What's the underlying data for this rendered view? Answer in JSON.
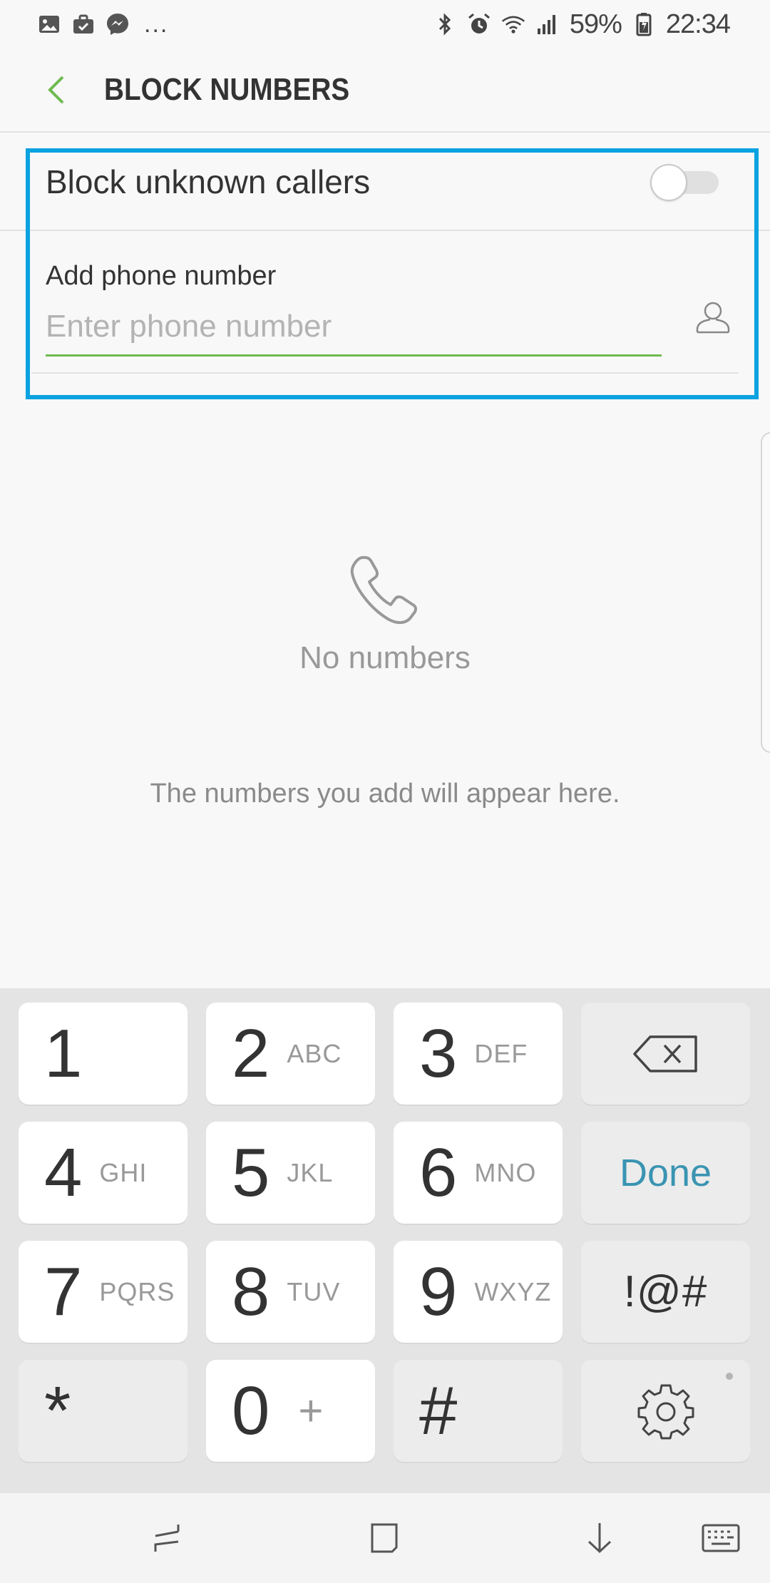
{
  "status_bar": {
    "notification_icons": [
      "gallery-icon",
      "briefcase-icon",
      "messenger-icon"
    ],
    "more_dots": "...",
    "battery_text": "59%",
    "time": "22:34"
  },
  "header": {
    "title": "BLOCK NUMBERS"
  },
  "settings": {
    "block_unknown_label": "Block unknown callers",
    "block_unknown_enabled": false,
    "add_label": "Add phone number",
    "phone_placeholder": "Enter phone number",
    "phone_value": ""
  },
  "empty_state": {
    "title": "No numbers",
    "subtitle": "The numbers you add will appear here."
  },
  "keypad": {
    "rows": [
      [
        {
          "digit": "1",
          "letters": ""
        },
        {
          "digit": "2",
          "letters": "ABC"
        },
        {
          "digit": "3",
          "letters": "DEF"
        }
      ],
      [
        {
          "digit": "4",
          "letters": "GHI"
        },
        {
          "digit": "5",
          "letters": "JKL"
        },
        {
          "digit": "6",
          "letters": "MNO"
        }
      ],
      [
        {
          "digit": "7",
          "letters": "PQRS"
        },
        {
          "digit": "8",
          "letters": "TUV"
        },
        {
          "digit": "9",
          "letters": "WXYZ"
        }
      ],
      [
        {
          "digit": "*",
          "letters": ""
        },
        {
          "digit": "0",
          "letters": "+"
        },
        {
          "digit": "#",
          "letters": ""
        }
      ]
    ],
    "done_label": "Done",
    "symbols_label": "!@#"
  },
  "colors": {
    "accent_green": "#6fba4f",
    "highlight_blue": "#0aa2e0",
    "done_blue": "#3a94b2"
  }
}
